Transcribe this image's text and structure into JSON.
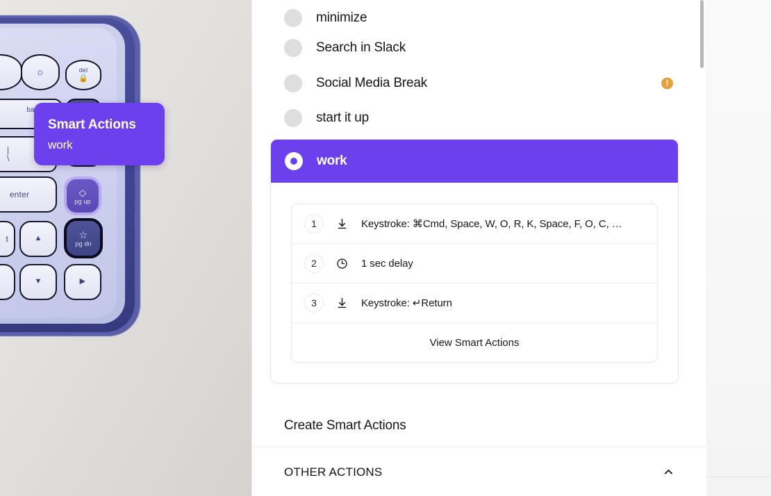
{
  "tooltip": {
    "title": "Smart Actions",
    "subtitle": "work",
    "background_color": "#6c40ec"
  },
  "keyboard": {
    "keys": [
      {
        "cap": "del",
        "glyph": "⌂",
        "name": "del-lock-key"
      },
      {
        "cap": "",
        "glyph": "☼",
        "name": "brightness-key"
      },
      {
        "cap": "backspace",
        "glyph": "",
        "name": "backspace-key"
      },
      {
        "cap": "",
        "glyph": "|\n\\",
        "name": "backslash-key"
      },
      {
        "cap": "enter",
        "glyph": "",
        "name": "enter-key"
      },
      {
        "cap": "pg up",
        "glyph": "◇",
        "name": "pg-up-smart-actions-key"
      },
      {
        "cap": "pg dn",
        "glyph": "☆",
        "name": "pg-dn-star-key"
      },
      {
        "cap": "",
        "glyph": "▲",
        "name": "arrow-up-key"
      },
      {
        "cap": "",
        "glyph": "▼",
        "name": "arrow-down-key"
      },
      {
        "cap": "",
        "glyph": "▶",
        "name": "arrow-right-key"
      },
      {
        "cap": "t",
        "glyph": "",
        "name": "shift-key"
      }
    ]
  },
  "panel": {
    "actions": [
      {
        "label": "minimize",
        "selected": false,
        "warning": false
      },
      {
        "label": "Search in Slack",
        "selected": false,
        "warning": false
      },
      {
        "label": "Social Media Break",
        "selected": false,
        "warning": true
      },
      {
        "label": "start it up",
        "selected": false,
        "warning": false
      }
    ],
    "warning_badge_glyph": "!",
    "warning_badge_color": "#e7a13c",
    "selected_action": {
      "label": "work",
      "accent_color": "#6c40ec",
      "steps": [
        {
          "number": "1",
          "icon": "keystroke-icon",
          "text": "Keystroke: ⌘Cmd, Space, W, O, R, K, Space, F, O, C, …"
        },
        {
          "number": "2",
          "icon": "clock-icon",
          "text": "1 sec delay"
        },
        {
          "number": "3",
          "icon": "keystroke-icon",
          "text": "Keystroke: ↵Return"
        }
      ],
      "view_link": "View Smart Actions"
    },
    "create_label": "Create Smart Actions",
    "other_section": {
      "title": "OTHER ACTIONS",
      "collapse_icon": "chevron-up-icon"
    }
  }
}
